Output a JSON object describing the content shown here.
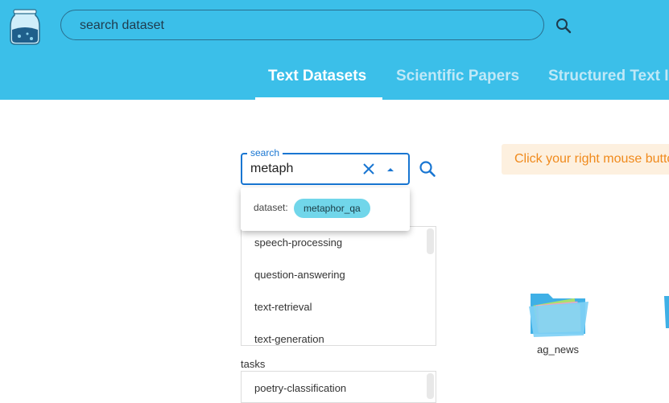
{
  "header": {
    "search_placeholder": "search dataset",
    "tabs": [
      {
        "label": "Text Datasets",
        "active": true
      },
      {
        "label": "Scientific Papers",
        "active": false
      },
      {
        "label": "Structured Text I",
        "active": false
      }
    ]
  },
  "search": {
    "legend": "search",
    "value": "metaph"
  },
  "autocomplete": {
    "label": "dataset:",
    "chip": "metaphor_qa"
  },
  "list": {
    "items": [
      "speech-processing",
      "question-answering",
      "text-retrieval",
      "text-generation"
    ]
  },
  "tasks": {
    "label": "tasks",
    "items": [
      "poetry-classification"
    ]
  },
  "hint": {
    "text": "Click your right mouse butto"
  },
  "folders": [
    {
      "label": "ag_news"
    }
  ],
  "colors": {
    "header_bg": "#3bbfe9",
    "accent": "#1976d2",
    "chip_bg": "#71d6ea",
    "hint_bg": "#fdf0df",
    "hint_text": "#f08a1c"
  }
}
